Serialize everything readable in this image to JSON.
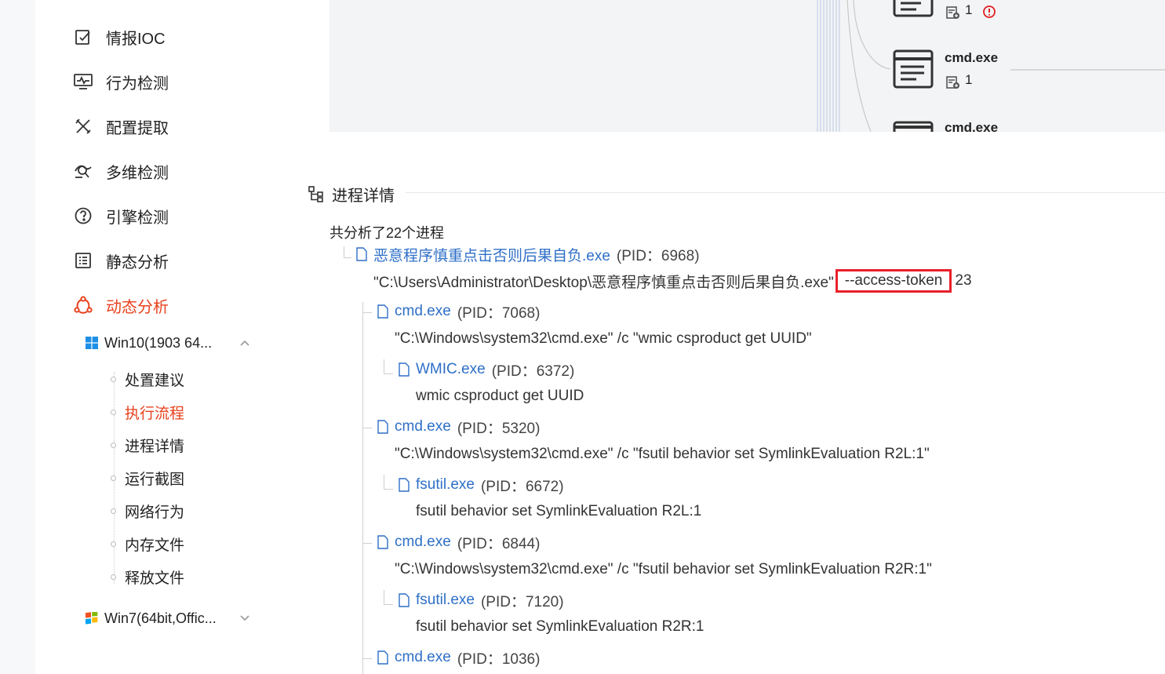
{
  "sidebar": {
    "items": [
      {
        "label": "情报IOC",
        "icon": "edit-report-icon"
      },
      {
        "label": "行为检测",
        "icon": "monitor-pulse-icon"
      },
      {
        "label": "配置提取",
        "icon": "tools-icon"
      },
      {
        "label": "多维检测",
        "icon": "multi-scan-icon"
      },
      {
        "label": "引擎检测",
        "icon": "engine-gauge-icon"
      },
      {
        "label": "静态分析",
        "icon": "list-document-icon"
      },
      {
        "label": "动态分析",
        "icon": "dynamic-nodes-icon"
      }
    ],
    "env1": {
      "label": "Win10(1903 64...",
      "icon": "windows10-logo-icon"
    },
    "env1_children": [
      "处置建议",
      "执行流程",
      "进程详情",
      "运行截图",
      "网络行为",
      "内存文件",
      "释放文件"
    ],
    "env2": {
      "label": "Win7(64bit,Offic...",
      "icon": "windows7-logo-icon"
    }
  },
  "graph": {
    "nodes": [
      {
        "label": "",
        "count": "1",
        "has_alert": true
      },
      {
        "label": "cmd.exe",
        "count": "1"
      },
      {
        "label": "cmd.exe",
        "count": ""
      }
    ]
  },
  "process_section": {
    "title": "进程详情",
    "summary": "共分析了22个进程",
    "root": {
      "name": "恶意程序慎重点击否则后果自负.exe",
      "pid": "(PID：6968)",
      "cmd_prefix": "\"C:\\Users\\Administrator\\Desktop\\恶意程序慎重点击否则后果自负.exe\"",
      "cmd_highlight": "--access-token",
      "cmd_suffix": "23"
    },
    "children": [
      {
        "name": "cmd.exe",
        "pid": "(PID：7068)",
        "cmd": "\"C:\\Windows\\system32\\cmd.exe\" /c \"wmic csproduct get UUID\"",
        "child": {
          "name": "WMIC.exe",
          "pid": "(PID：6372)",
          "cmd": "wmic csproduct get UUID"
        }
      },
      {
        "name": "cmd.exe",
        "pid": "(PID：5320)",
        "cmd": "\"C:\\Windows\\system32\\cmd.exe\" /c \"fsutil behavior set SymlinkEvaluation R2L:1\"",
        "child": {
          "name": "fsutil.exe",
          "pid": "(PID：6672)",
          "cmd": "fsutil behavior set SymlinkEvaluation R2L:1"
        }
      },
      {
        "name": "cmd.exe",
        "pid": "(PID：6844)",
        "cmd": "\"C:\\Windows\\system32\\cmd.exe\" /c \"fsutil behavior set SymlinkEvaluation R2R:1\"",
        "child": {
          "name": "fsutil.exe",
          "pid": "(PID：7120)",
          "cmd": "fsutil behavior set SymlinkEvaluation R2R:1"
        }
      },
      {
        "name": "cmd.exe",
        "pid": "(PID：1036)"
      }
    ]
  },
  "colors": {
    "accent": "#e8401c",
    "link": "#2e6fc7",
    "highlight_border": "#e8202a"
  }
}
